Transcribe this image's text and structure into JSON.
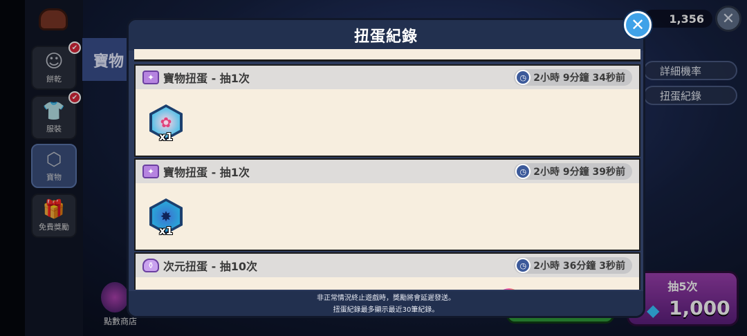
{
  "sidebar": {
    "items": [
      {
        "label": "餅乾",
        "icon": "cookie-face-icon"
      },
      {
        "label": "服裝",
        "icon": "shirt-icon"
      },
      {
        "label": "寶物",
        "icon": "hexagon-treasure-icon"
      },
      {
        "label": "免費獎勵",
        "icon": "gift-icon"
      }
    ],
    "point_shop_label": "點數商店"
  },
  "background_panel": {
    "title": "寶物"
  },
  "top_bar": {
    "gem_count": "1,356"
  },
  "side_buttons": {
    "rates": "詳細機率",
    "history": "扭蛋紀錄"
  },
  "draw_button": {
    "label": "抽5次",
    "price": "1,000"
  },
  "modal": {
    "title": "扭蛋紀錄",
    "records": [
      {
        "title": "寶物扭蛋 - 抽1次",
        "time": "2小時 9分鐘 34秒前",
        "qty": "x1",
        "icon": "treasure-ticket-icon"
      },
      {
        "title": "寶物扭蛋 - 抽1次",
        "time": "2小時 9分鐘 39秒前",
        "qty": "x1",
        "icon": "treasure-ticket-icon"
      },
      {
        "title": "次元扭蛋 - 抽10次",
        "time": "2小時 36分鐘 3秒前",
        "icon": "potion-icon"
      }
    ],
    "footer": [
      "非正常情況終止遊戲時，獎勵將會延遲發送。",
      "扭蛋紀錄最多顯示最近30筆紀錄。"
    ]
  }
}
